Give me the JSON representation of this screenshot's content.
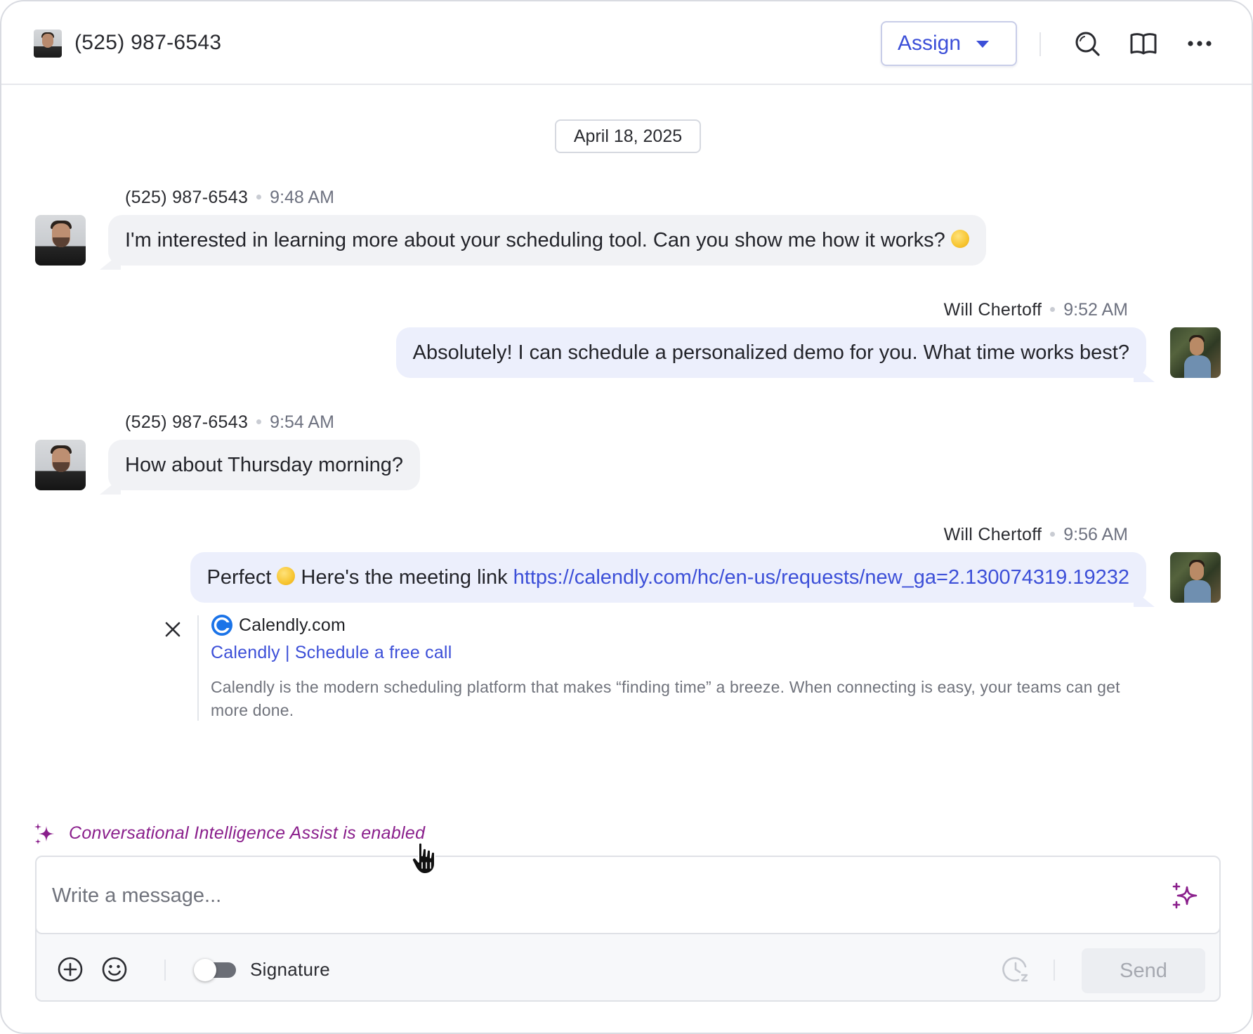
{
  "header": {
    "contact_name": "(525) 987-6543",
    "assign_label": "Assign",
    "icons": [
      "search-icon",
      "knowledge-book-icon",
      "more-options-icon"
    ]
  },
  "conversation": {
    "date": "April 18, 2025",
    "messages": [
      {
        "sender": "(525) 987-6543",
        "time": "9:48 AM",
        "direction": "incoming",
        "text": "I'm interested in learning more about your scheduling tool. Can you show me how it works?",
        "emoji": "thinking-face"
      },
      {
        "sender": "Will Chertoff",
        "time": "9:52 AM",
        "direction": "outgoing",
        "text": "Absolutely! I can schedule a personalized demo for you. What time works best?"
      },
      {
        "sender": "(525) 987-6543",
        "time": "9:54 AM",
        "direction": "incoming",
        "text": "How about Thursday morning?"
      },
      {
        "sender": "Will Chertoff",
        "time": "9:56 AM",
        "direction": "outgoing",
        "text_before": "Perfect",
        "emoji": "ok-hand",
        "text_after": "Here's the meeting link",
        "link": "https://calendly.com/hc/en-us/requests/new_ga=2.130074319.19232"
      }
    ],
    "link_preview": {
      "site": "Calendly.com",
      "title": "Calendly | Schedule a free call",
      "description": "Calendly is the modern scheduling platform that makes “finding time” a breeze. When connecting is easy, your teams can get more done."
    }
  },
  "ai_notice": "Conversational Intelligence Assist is enabled",
  "composer": {
    "placeholder": "Write a message...",
    "value": "",
    "signature_label": "Signature",
    "signature_enabled": false,
    "send_label": "Send"
  },
  "colors": {
    "accent": "#3c4fd8",
    "ai_purple": "#8a1f8c",
    "incoming_bubble": "#f1f2f5",
    "outgoing_bubble": "#eceffc"
  }
}
